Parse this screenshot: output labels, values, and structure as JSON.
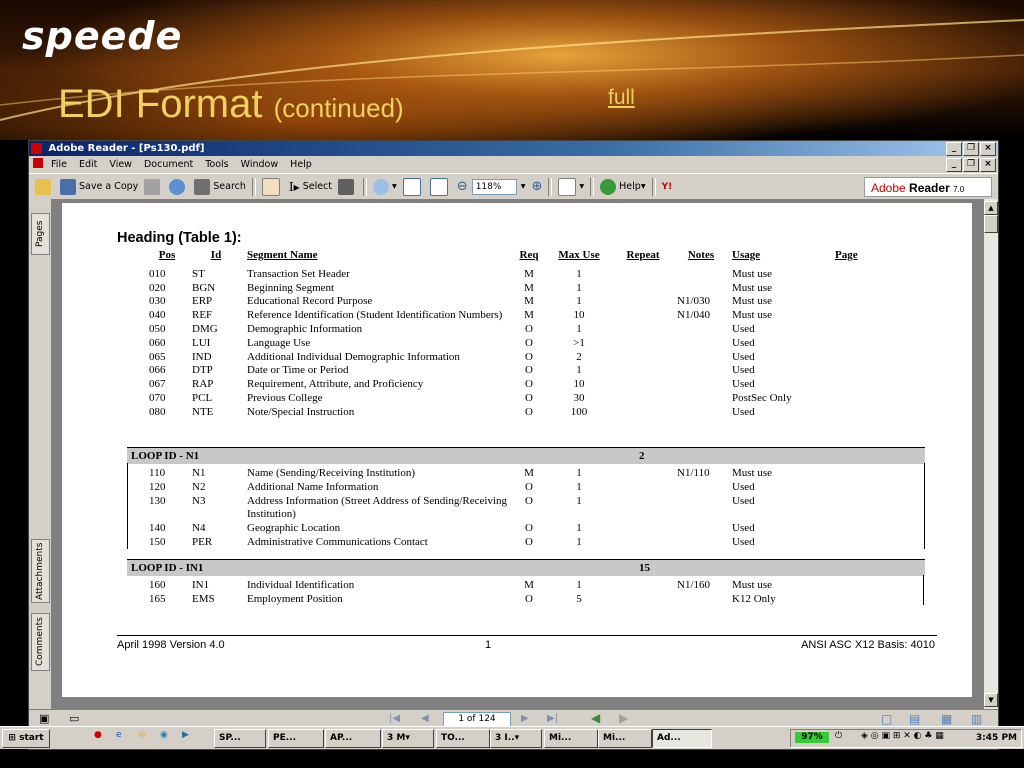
{
  "slide": {
    "logo": "speede",
    "title": "EDI Format",
    "title_suffix": "(continued)",
    "link": "full"
  },
  "window": {
    "title": "Adobe Reader - [Ps130.pdf]",
    "menu": [
      "File",
      "Edit",
      "View",
      "Document",
      "Tools",
      "Window",
      "Help"
    ],
    "toolbar": {
      "save_copy": "Save a Copy",
      "search": "Search",
      "select": "Select",
      "zoom": "118%",
      "help": "Help",
      "brand": "Adobe",
      "brand_product": "Reader",
      "brand_version": "7.0"
    },
    "side_tabs": [
      "Pages",
      "Attachments",
      "Comments"
    ],
    "page_indicator": "1 of 124"
  },
  "document": {
    "heading": "Heading  (Table 1):",
    "columns": [
      "Pos",
      "Id",
      "Segment Name",
      "Req",
      "Max Use",
      "Repeat",
      "Notes",
      "Usage",
      "Page"
    ],
    "rows": [
      {
        "pos": "010",
        "id": "ST",
        "name": "Transaction Set Header",
        "req": "M",
        "max": "1",
        "repeat": "",
        "notes": "",
        "usage": "Must use"
      },
      {
        "pos": "020",
        "id": "BGN",
        "name": "Beginning Segment",
        "req": "M",
        "max": "1",
        "repeat": "",
        "notes": "",
        "usage": "Must use"
      },
      {
        "pos": "030",
        "id": "ERP",
        "name": "Educational Record Purpose",
        "req": "M",
        "max": "1",
        "repeat": "",
        "notes": "N1/030",
        "usage": "Must use"
      },
      {
        "pos": "040",
        "id": "REF",
        "name": "Reference Identification (Student Identification Numbers)",
        "req": "M",
        "max": "10",
        "repeat": "",
        "notes": "N1/040",
        "usage": "Must use"
      },
      {
        "pos": "050",
        "id": "DMG",
        "name": "Demographic Information",
        "req": "O",
        "max": "1",
        "repeat": "",
        "notes": "",
        "usage": "Used"
      },
      {
        "pos": "060",
        "id": "LUI",
        "name": "Language Use",
        "req": "O",
        "max": ">1",
        "repeat": "",
        "notes": "",
        "usage": "Used"
      },
      {
        "pos": "065",
        "id": "IND",
        "name": "Additional Individual Demographic Information",
        "req": "O",
        "max": "2",
        "repeat": "",
        "notes": "",
        "usage": "Used"
      },
      {
        "pos": "066",
        "id": "DTP",
        "name": "Date or Time or Period",
        "req": "O",
        "max": "1",
        "repeat": "",
        "notes": "",
        "usage": "Used"
      },
      {
        "pos": "067",
        "id": "RAP",
        "name": "Requirement, Attribute, and Proficiency",
        "req": "O",
        "max": "10",
        "repeat": "",
        "notes": "",
        "usage": "Used"
      },
      {
        "pos": "070",
        "id": "PCL",
        "name": "Previous College",
        "req": "O",
        "max": "30",
        "repeat": "",
        "notes": "",
        "usage": "PostSec Only"
      },
      {
        "pos": "080",
        "id": "NTE",
        "name": "Note/Special Instruction",
        "req": "O",
        "max": "100",
        "repeat": "",
        "notes": "",
        "usage": "Used"
      }
    ],
    "loops": [
      {
        "name": "LOOP ID - N1",
        "repeat": "2",
        "rows": [
          {
            "pos": "110",
            "id": "N1",
            "name": "Name (Sending/Receiving Institution)",
            "req": "M",
            "max": "1",
            "notes": "N1/110",
            "usage": "Must use"
          },
          {
            "pos": "120",
            "id": "N2",
            "name": "Additional Name Information",
            "req": "O",
            "max": "1",
            "notes": "",
            "usage": "Used"
          },
          {
            "pos": "130",
            "id": "N3",
            "name": "Address Information (Street Address of Sending/Receiving Institution)",
            "req": "O",
            "max": "1",
            "notes": "",
            "usage": "Used"
          },
          {
            "pos": "140",
            "id": "N4",
            "name": "Geographic Location",
            "req": "O",
            "max": "1",
            "notes": "",
            "usage": "Used"
          },
          {
            "pos": "150",
            "id": "PER",
            "name": "Administrative Communications Contact",
            "req": "O",
            "max": "1",
            "notes": "",
            "usage": "Used"
          }
        ]
      },
      {
        "name": "LOOP ID - IN1",
        "repeat": "15",
        "rows": [
          {
            "pos": "160",
            "id": "IN1",
            "name": "Individual Identification",
            "req": "M",
            "max": "1",
            "notes": "N1/160",
            "usage": "Must use"
          },
          {
            "pos": "165",
            "id": "EMS",
            "name": "Employment Position",
            "req": "O",
            "max": "5",
            "notes": "",
            "usage": "K12 Only"
          }
        ]
      }
    ],
    "footer": {
      "left": "April 1998 Version 4.0",
      "center": "1",
      "right": "ANSI ASC X12 Basis: 4010"
    }
  },
  "taskbar": {
    "start": "start",
    "tasks": [
      "SP...",
      "PE...",
      "AP...",
      "3 M▾",
      "TO...",
      "3 I..▾",
      "Mi...",
      "Mi...",
      "Ad..."
    ],
    "battery": "97%",
    "clock": "3:45 PM"
  },
  "colors": {
    "slide_title": "#f0d060",
    "titlebar": "#0a246a",
    "adobe_red": "#cc0000"
  }
}
